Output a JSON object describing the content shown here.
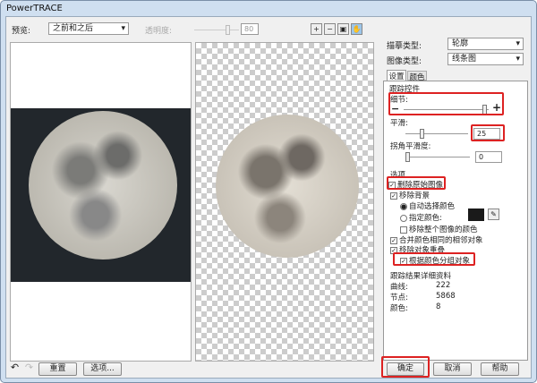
{
  "window": {
    "title": "PowerTRACE"
  },
  "preview": {
    "label": "预览:",
    "mode": "之前和之后",
    "transparency_label": "透明度:",
    "transparency_value": "80"
  },
  "zoom_tools": [
    "zoom-in-icon",
    "zoom-out-icon",
    "fit-icon",
    "pan-icon"
  ],
  "panel": {
    "trace_type_label": "描摹类型:",
    "trace_type": "轮廓",
    "image_type_label": "图像类型:",
    "image_type": "线条图",
    "tabs": [
      "设置",
      "颜色"
    ],
    "trace_controls": {
      "title": "跟踪控件",
      "detail_label": "细节:",
      "detail_level": 0.95,
      "smoothing_label": "平滑:",
      "smoothing_value": "25",
      "corner_label": "拐角平滑度:",
      "corner_value": "0"
    },
    "options": {
      "title": "选项",
      "delete_original": "删除原始图像",
      "remove_background": "移除背景",
      "auto_color": "自动选择颜色",
      "specify_color": "指定颜色:",
      "specified_color": "#1a1a1a",
      "remove_entire": "移除整个图像的颜色",
      "merge_adjacent": "合并颜色相同的相邻对象",
      "remove_overlap": "移除对象重叠",
      "group_by_color": "根据颜色分组对象"
    },
    "results": {
      "title": "跟踪结果详细资料",
      "curves_label": "曲线:",
      "curves": "222",
      "nodes_label": "节点:",
      "nodes": "5868",
      "colors_label": "颜色:",
      "colors": "8"
    }
  },
  "footer": {
    "reset": "重置",
    "options": "选项...",
    "ok": "确定",
    "cancel": "取消",
    "help": "帮助"
  }
}
